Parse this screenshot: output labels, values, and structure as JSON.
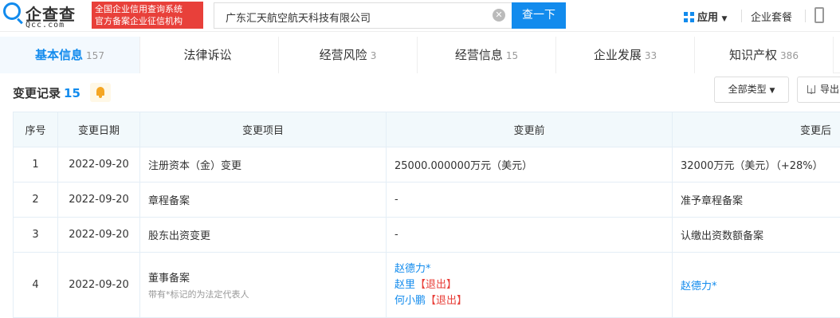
{
  "header": {
    "logo_text": "企查查",
    "logo_sub": "Qcc.com",
    "badge_line1": "全国企业信用查询系统",
    "badge_line2": "官方备案企业征信机构",
    "search_value": "广东汇天航空航天科技有限公司",
    "search_button": "查一下",
    "apps_label": "应用",
    "suite_label": "企业套餐"
  },
  "tabs": [
    {
      "label": "基本信息",
      "count": "157"
    },
    {
      "label": "法律诉讼",
      "count": ""
    },
    {
      "label": "经营风险",
      "count": "3"
    },
    {
      "label": "经营信息",
      "count": "15"
    },
    {
      "label": "企业发展",
      "count": "33"
    },
    {
      "label": "知识产权",
      "count": "386"
    }
  ],
  "section": {
    "title": "变更记录",
    "count": "15",
    "type_filter": "全部类型",
    "export_label": "导出"
  },
  "table": {
    "headers": [
      "序号",
      "变更日期",
      "变更项目",
      "变更前",
      "变更后"
    ],
    "rows": [
      {
        "no": "1",
        "date": "2022-09-20",
        "item": "注册资本（金）变更",
        "before": "25000.000000万元（美元）",
        "after": "32000万元（美元）（+28%）"
      },
      {
        "no": "2",
        "date": "2022-09-20",
        "item": "章程备案",
        "before": "-",
        "after": "准予章程备案"
      },
      {
        "no": "3",
        "date": "2022-09-20",
        "item": "股东出资变更",
        "before": "-",
        "after": "认缴出资数额备案"
      },
      {
        "no": "4",
        "date": "2022-09-20",
        "item": "董事备案",
        "item_note": "带有*标记的为法定代表人",
        "before_1": "赵德力*",
        "before_2_name": "赵里",
        "before_2_tag": "【退出】",
        "before_3_name": "何小鹏",
        "before_3_tag": "【退出】",
        "after": "赵德力*"
      }
    ]
  }
}
